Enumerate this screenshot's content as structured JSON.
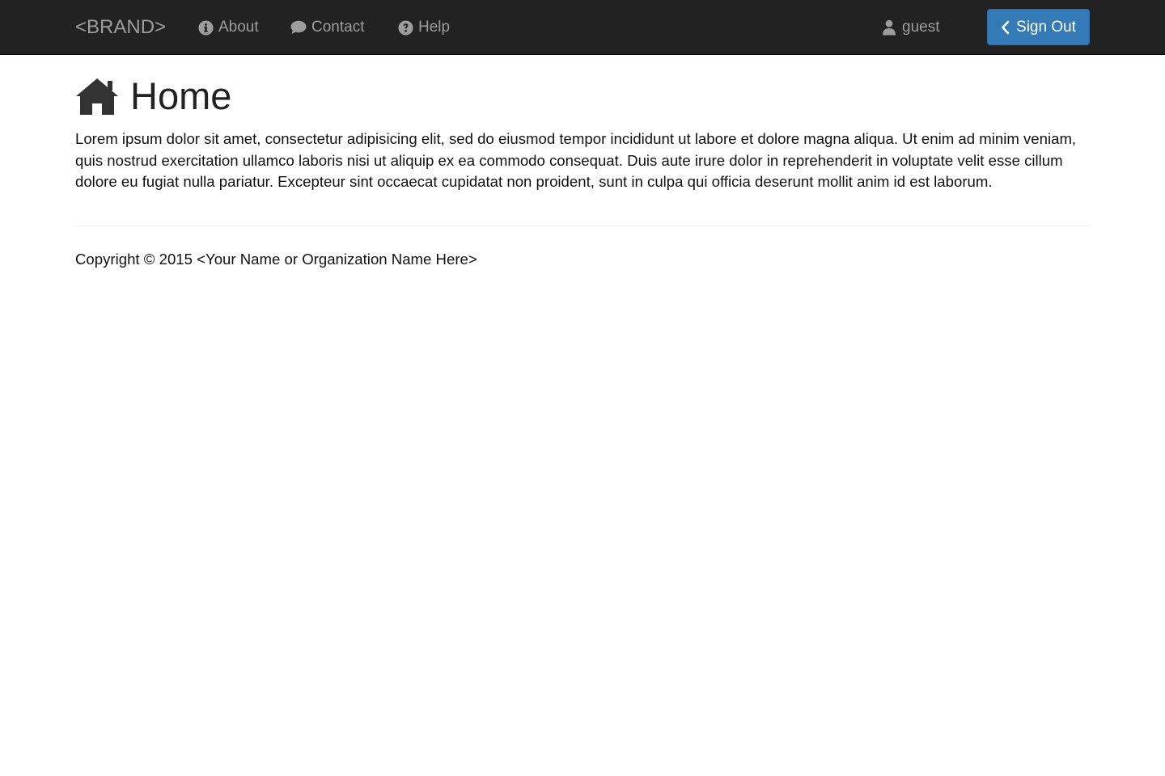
{
  "navbar": {
    "brand": "<BRAND>",
    "links": [
      {
        "label": "About",
        "icon": "info-circle-icon"
      },
      {
        "label": "Contact",
        "icon": "comment-icon"
      },
      {
        "label": "Help",
        "icon": "question-circle-icon"
      }
    ],
    "user": {
      "label": "guest",
      "icon": "user-icon"
    },
    "signout": {
      "label": "Sign Out",
      "icon": "chevron-left-icon"
    }
  },
  "main": {
    "title": "Home",
    "title_icon": "home-icon",
    "body": "Lorem ipsum dolor sit amet, consectetur adipisicing elit, sed do eiusmod tempor incididunt ut labore et dolore magna aliqua. Ut enim ad minim veniam, quis nostrud exercitation ullamco laboris nisi ut aliquip ex ea commodo consequat. Duis aute irure dolor in reprehenderit in voluptate velit esse cillum dolore eu fugiat nulla pariatur. Excepteur sint occaecat cupidatat non proident, sunt in culpa qui officia deserunt mollit anim id est laborum."
  },
  "footer": {
    "copyright": "Copyright © 2015 <Your Name or Organization Name Here>"
  },
  "colors": {
    "navbar_bg": "#222222",
    "nav_text": "#9d9d9d",
    "primary": "#337ab7"
  }
}
